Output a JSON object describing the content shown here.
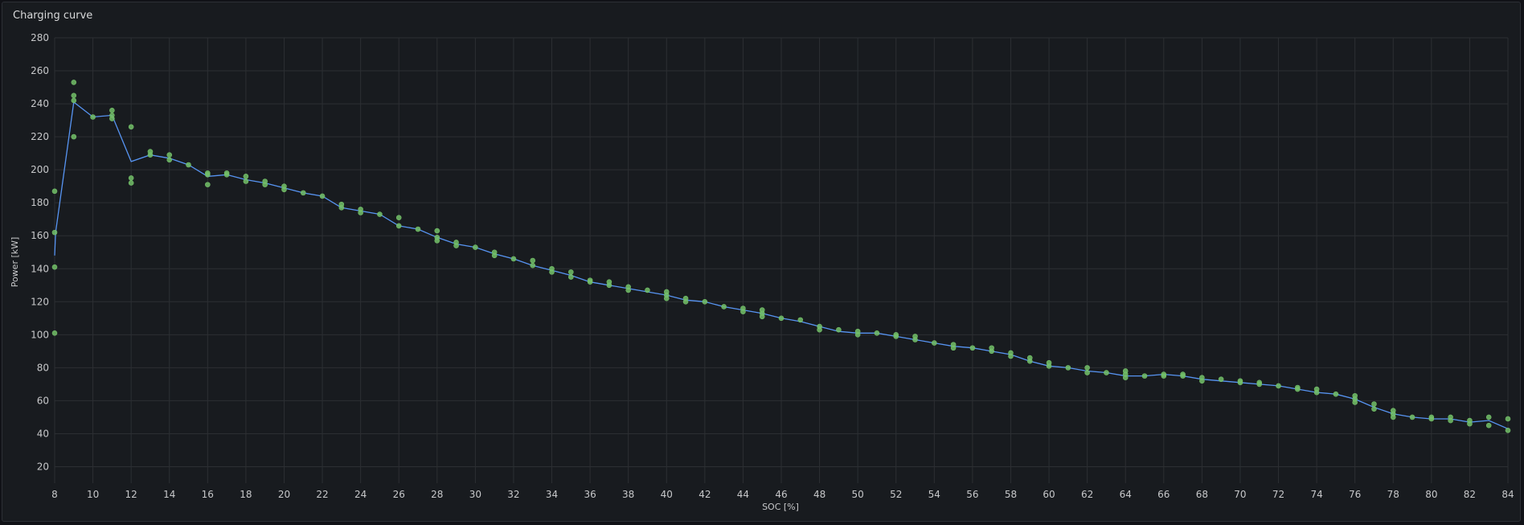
{
  "panel": {
    "title": "Charging curve"
  },
  "colors": {
    "grid": "#2c2f33",
    "line": "#5794f2",
    "point": "#73bf69",
    "text": "#c7c8ca",
    "background": "#181b1f"
  },
  "chart_data": {
    "type": "scatter",
    "title": "Charging curve",
    "xlabel": "SOC [%]",
    "ylabel": "Power [kW]",
    "xlim": [
      8,
      84
    ],
    "ylim": [
      10,
      280
    ],
    "xticks": [
      8,
      10,
      12,
      14,
      16,
      18,
      20,
      22,
      24,
      26,
      28,
      30,
      32,
      34,
      36,
      38,
      40,
      42,
      44,
      46,
      48,
      50,
      52,
      54,
      56,
      58,
      60,
      62,
      64,
      66,
      68,
      70,
      72,
      74,
      76,
      78,
      80,
      82,
      84
    ],
    "yticks": [
      20,
      40,
      60,
      80,
      100,
      120,
      140,
      160,
      180,
      200,
      220,
      240,
      260,
      280
    ],
    "grid": true,
    "legend": "none",
    "series": [
      {
        "type": "line",
        "x": [
          8,
          8.05,
          9,
          10,
          11,
          12,
          13,
          14,
          15,
          16,
          17,
          18,
          19,
          20,
          21,
          22,
          23,
          24,
          25,
          26,
          27,
          28,
          29,
          30,
          31,
          32,
          33,
          34,
          35,
          36,
          37,
          38,
          39,
          40,
          41,
          42,
          43,
          44,
          45,
          46,
          47,
          48,
          49,
          50,
          51,
          52,
          53,
          54,
          55,
          56,
          57,
          58,
          59,
          60,
          61,
          62,
          63,
          64,
          65,
          66,
          67,
          68,
          69,
          70,
          71,
          72,
          73,
          74,
          75,
          76,
          77,
          78,
          79,
          80,
          81,
          82,
          83,
          84
        ],
        "y": [
          148,
          162,
          241,
          232,
          233,
          205,
          209,
          207,
          203,
          196,
          197,
          194,
          192,
          189,
          186,
          184,
          177,
          175,
          173,
          166,
          164,
          159,
          155,
          153,
          149,
          146,
          142,
          139,
          136,
          132,
          130,
          128,
          126,
          124,
          121,
          120,
          117,
          115,
          113,
          110,
          108,
          105,
          102,
          101,
          101,
          99,
          97,
          95,
          93,
          92,
          90,
          88,
          84,
          81,
          80,
          78,
          77,
          75,
          75,
          76,
          75,
          73,
          72,
          71,
          70,
          69,
          67,
          65,
          64,
          61,
          56,
          52,
          50,
          49,
          49,
          47,
          48,
          43
        ]
      },
      {
        "type": "scatter",
        "x": [
          8,
          8,
          8,
          8,
          9,
          9,
          9,
          9,
          10,
          11,
          11,
          11,
          12,
          12,
          12,
          13,
          13,
          14,
          14,
          15,
          16,
          16,
          16,
          17,
          17,
          18,
          18,
          19,
          19,
          20,
          20,
          21,
          22,
          23,
          23,
          24,
          24,
          25,
          26,
          26,
          27,
          28,
          28,
          28,
          29,
          29,
          30,
          31,
          31,
          32,
          33,
          33,
          34,
          34,
          35,
          35,
          36,
          36,
          37,
          37,
          38,
          38,
          39,
          40,
          40,
          40,
          41,
          41,
          42,
          43,
          44,
          44,
          45,
          45,
          45,
          46,
          47,
          48,
          48,
          49,
          50,
          50,
          51,
          52,
          52,
          53,
          53,
          54,
          55,
          55,
          56,
          57,
          57,
          58,
          58,
          59,
          59,
          60,
          60,
          61,
          62,
          62,
          63,
          64,
          64,
          64,
          65,
          66,
          66,
          67,
          67,
          68,
          68,
          69,
          70,
          70,
          71,
          71,
          72,
          73,
          73,
          74,
          74,
          75,
          76,
          76,
          76,
          77,
          77,
          78,
          78,
          78,
          79,
          80,
          80,
          81,
          81,
          82,
          82,
          83,
          83,
          84,
          84
        ],
        "y": [
          187,
          162,
          141,
          101,
          253,
          245,
          242,
          220,
          232,
          236,
          233,
          231,
          226,
          195,
          192,
          211,
          209,
          209,
          206,
          203,
          198,
          197,
          191,
          198,
          197,
          196,
          193,
          193,
          191,
          190,
          188,
          186,
          184,
          179,
          177,
          176,
          174,
          173,
          171,
          166,
          164,
          163,
          159,
          157,
          156,
          154,
          153,
          150,
          148,
          146,
          145,
          142,
          140,
          138,
          138,
          135,
          133,
          132,
          132,
          130,
          129,
          127,
          127,
          126,
          124,
          122,
          122,
          120,
          120,
          117,
          116,
          114,
          115,
          113,
          111,
          110,
          109,
          105,
          103,
          103,
          102,
          100,
          101,
          100,
          99,
          99,
          97,
          95,
          94,
          92,
          92,
          92,
          90,
          89,
          87,
          86,
          84,
          83,
          81,
          80,
          80,
          77,
          77,
          78,
          76,
          74,
          75,
          76,
          75,
          76,
          75,
          74,
          72,
          73,
          72,
          71,
          71,
          70,
          69,
          68,
          67,
          67,
          65,
          64,
          63,
          61,
          59,
          58,
          55,
          54,
          52,
          50,
          50,
          50,
          49,
          50,
          48,
          48,
          46,
          50,
          45,
          49,
          42
        ]
      }
    ]
  }
}
